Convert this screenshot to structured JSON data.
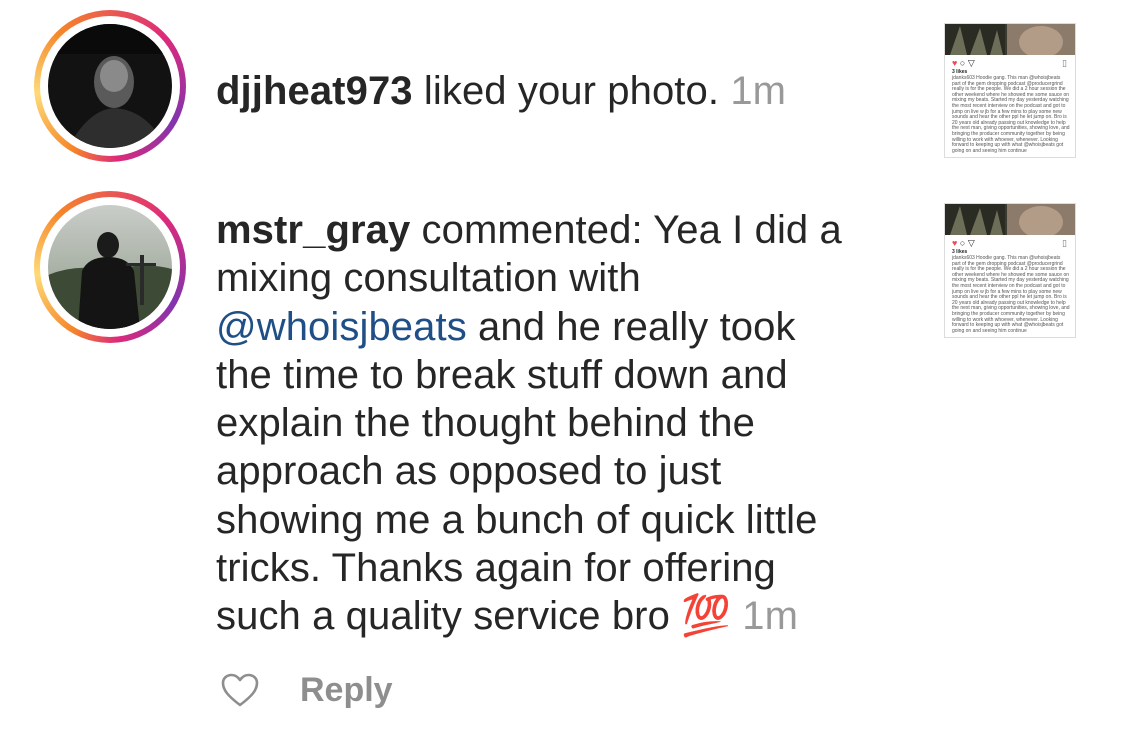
{
  "notifications": [
    {
      "username": "djjheat973",
      "action": " liked your photo.",
      "time": "1m",
      "avatar_icon": "profile-photo-man-bw",
      "thumbnail_icon": "post-screenshot-thumbnail"
    },
    {
      "username": "mstr_gray",
      "action_prefix": " commented: ",
      "lines": [
        "Yea I did a",
        "mixing consultation with"
      ],
      "mention": "@whoisjbeats",
      "line3_rest": " and he really took",
      "lines_after": [
        "the time to break stuff down and",
        "explain the thought behind the",
        "approach as opposed to just",
        "showing me a bunch of quick little",
        "tricks. Thanks again for offering"
      ],
      "last_line": "such a quality service bro ",
      "emoji": "💯",
      "time": "1m",
      "avatar_icon": "profile-photo-silhouette",
      "thumbnail_icon": "post-screenshot-thumbnail"
    }
  ],
  "thumbnail": {
    "likes": "3 likes",
    "caption": "jdanks603 Hoodie gang. This man @whoisjbeats part of the gem dropping podcast @producergrind really is for the people. We did a 2 hour session the other weekend where he showed me some sauce on mixing my beats. Started my day yesterday watching the most recent interview on the podcast and got to jump on live w jb for a few mins to play some new sounds and hear the other ppl he let jump on. Bro is 20 years old already passing out knowledge to help the next man, giving opportunities, showing love, and bringing the producer community together by being willing to work with whoever, whenever. Looking forward to keeping up with what @whoisjbeats got going on and seeing him continue"
  },
  "actions": {
    "like_icon": "heart-outline-icon",
    "reply_label": "Reply"
  },
  "colors": {
    "text": "#262626",
    "mention": "#1f4f86",
    "muted": "#999999",
    "reply": "#8e8e8e"
  }
}
